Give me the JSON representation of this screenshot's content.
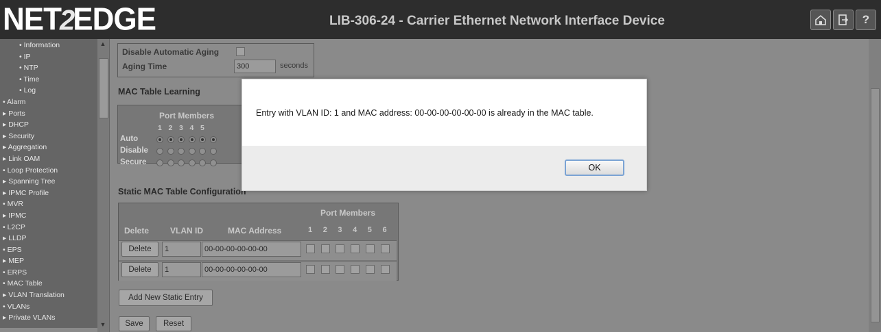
{
  "header": {
    "logo_left": "NET",
    "logo_two": "2",
    "logo_right": "EDGE",
    "title": "LIB-306-24 - Carrier Ethernet Network Interface Device",
    "icons": [
      "home-icon",
      "logout-icon",
      "help-icon"
    ],
    "help_glyph": "?"
  },
  "sidebar": {
    "items": [
      {
        "label": "• Information",
        "level": "sub"
      },
      {
        "label": "• IP",
        "level": "sub"
      },
      {
        "label": "• NTP",
        "level": "sub"
      },
      {
        "label": "• Time",
        "level": "sub"
      },
      {
        "label": "• Log",
        "level": "sub"
      },
      {
        "label": "• Alarm",
        "level": "top"
      },
      {
        "label": "▸ Ports",
        "level": "top"
      },
      {
        "label": "▸ DHCP",
        "level": "top"
      },
      {
        "label": "▸ Security",
        "level": "top"
      },
      {
        "label": "▸ Aggregation",
        "level": "top"
      },
      {
        "label": "▸ Link OAM",
        "level": "top"
      },
      {
        "label": "• Loop Protection",
        "level": "top"
      },
      {
        "label": "▸ Spanning Tree",
        "level": "top"
      },
      {
        "label": "▸ IPMC Profile",
        "level": "top"
      },
      {
        "label": "• MVR",
        "level": "top"
      },
      {
        "label": "▸ IPMC",
        "level": "top"
      },
      {
        "label": "• L2CP",
        "level": "top"
      },
      {
        "label": "▸ LLDP",
        "level": "top"
      },
      {
        "label": "• EPS",
        "level": "top"
      },
      {
        "label": "▸ MEP",
        "level": "top"
      },
      {
        "label": "• ERPS",
        "level": "top"
      },
      {
        "label": "• MAC Table",
        "level": "top"
      },
      {
        "label": "▸ VLAN Translation",
        "level": "top"
      },
      {
        "label": "• VLANs",
        "level": "top"
      },
      {
        "label": "▸ Private VLANs",
        "level": "top"
      }
    ]
  },
  "aging": {
    "disable_label": "Disable Automatic Aging",
    "aging_time_label": "Aging Time",
    "aging_time_value": "300",
    "unit": "seconds"
  },
  "learning": {
    "title": "MAC Table Learning",
    "port_members_header": "Port Members",
    "ports": [
      "1",
      "2",
      "3",
      "4",
      "5"
    ],
    "rows": [
      "Auto",
      "Disable",
      "Secure"
    ]
  },
  "static": {
    "title": "Static MAC Table Configuration",
    "port_members_header": "Port Members",
    "columns": {
      "delete": "Delete",
      "vlan": "VLAN ID",
      "mac": "MAC Address"
    },
    "ports": [
      "1",
      "2",
      "3",
      "4",
      "5",
      "6"
    ],
    "entries": [
      {
        "delete_label": "Delete",
        "vlan": "1",
        "mac": "00-00-00-00-00-00"
      },
      {
        "delete_label": "Delete",
        "vlan": "1",
        "mac": "00-00-00-00-00-00"
      }
    ],
    "add_label": "Add New Static Entry",
    "save_label": "Save",
    "reset_label": "Reset"
  },
  "dialog": {
    "message": "Entry with VLAN ID: 1 and MAC address: 00-00-00-00-00-00 is already in the MAC table.",
    "ok_label": "OK"
  }
}
